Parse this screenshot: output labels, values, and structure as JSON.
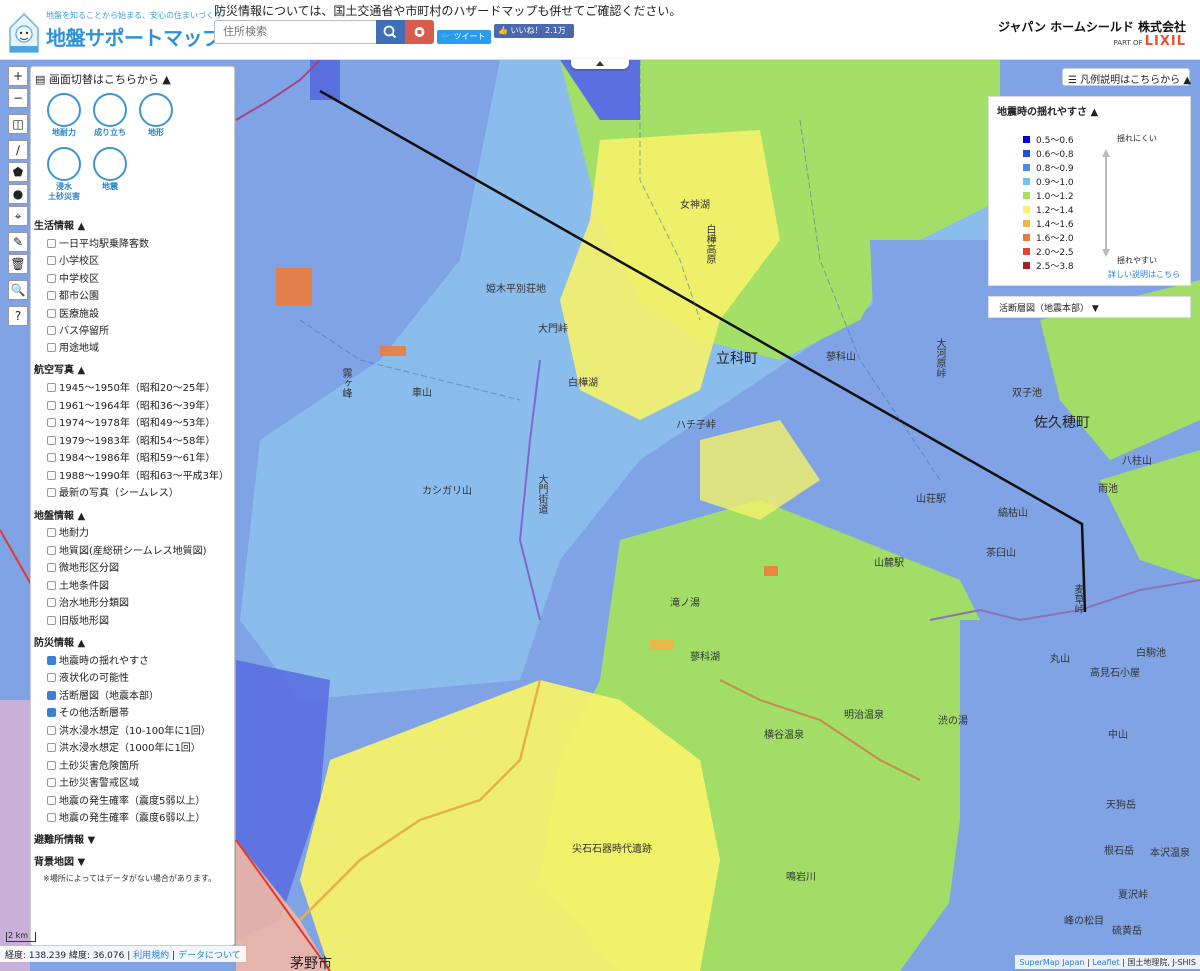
{
  "header": {
    "tagline": "地盤を知ることから始まる、安心の住まいづくり",
    "brand": "地盤サポートマップ",
    "notice": "防災情報については、国土交通省や市町村のハザードマップも併せてご確認ください。",
    "search_placeholder": "住所検索",
    "tweet_label": "ツイート",
    "like_label": "いいね！ 2.1万",
    "company": "ジャパン ホームシールド 株式会社",
    "partof": "PART OF",
    "partof_brand": "LIXIL"
  },
  "map_tools": [
    "+",
    "−",
    "◫",
    "∕",
    "⬟",
    "●",
    "⌖",
    "✎",
    "🗑",
    "🔍",
    "?"
  ],
  "left_panel": {
    "head": "画面切替はこちらから ▲",
    "views": [
      {
        "label": "地耐力",
        "icon": "house-ground-icon"
      },
      {
        "label": "成り立ち",
        "icon": "layers-icon"
      },
      {
        "label": "地形",
        "icon": "terrain-icon"
      },
      {
        "label": "浸水\n土砂災害",
        "icon": "flood-icon"
      },
      {
        "label": "地震",
        "icon": "earthquake-icon"
      }
    ],
    "sections": [
      {
        "title": "生活情報 ▲",
        "items": [
          {
            "label": "一日平均駅乗降客数",
            "checked": false
          },
          {
            "label": "小学校区",
            "checked": false
          },
          {
            "label": "中学校区",
            "checked": false
          },
          {
            "label": "都市公園",
            "checked": false
          },
          {
            "label": "医療施設",
            "checked": false
          },
          {
            "label": "バス停留所",
            "checked": false
          },
          {
            "label": "用途地域",
            "checked": false
          }
        ]
      },
      {
        "title": "航空写真 ▲",
        "items": [
          {
            "label": "1945〜1950年（昭和20〜25年）",
            "checked": false
          },
          {
            "label": "1961〜1964年（昭和36〜39年）",
            "checked": false
          },
          {
            "label": "1974〜1978年（昭和49〜53年）",
            "checked": false
          },
          {
            "label": "1979〜1983年（昭和54〜58年）",
            "checked": false
          },
          {
            "label": "1984〜1986年（昭和59〜61年）",
            "checked": false
          },
          {
            "label": "1988〜1990年（昭和63〜平成3年）",
            "checked": false
          },
          {
            "label": "最新の写真（シームレス）",
            "checked": false
          }
        ]
      },
      {
        "title": "地盤情報 ▲",
        "items": [
          {
            "label": "地耐力",
            "checked": false
          },
          {
            "label": "地質図(産総研シームレス地質図)",
            "checked": false
          },
          {
            "label": "微地形区分図",
            "checked": false
          },
          {
            "label": "土地条件図",
            "checked": false
          },
          {
            "label": "治水地形分類図",
            "checked": false
          },
          {
            "label": "旧版地形図",
            "checked": false
          }
        ]
      },
      {
        "title": "防災情報 ▲",
        "items": [
          {
            "label": "地震時の揺れやすさ",
            "checked": true
          },
          {
            "label": "液状化の可能性",
            "checked": false
          },
          {
            "label": "活断層図（地震本部）",
            "checked": true
          },
          {
            "label": "その他活断層帯",
            "checked": true
          },
          {
            "label": "洪水浸水想定（10-100年に1回）",
            "checked": false
          },
          {
            "label": "洪水浸水想定（1000年に1回）",
            "checked": false
          },
          {
            "label": "土砂災害危険箇所",
            "checked": false
          },
          {
            "label": "土砂災害警戒区域",
            "checked": false
          },
          {
            "label": "地震の発生確率（震度5弱以上）",
            "checked": false
          },
          {
            "label": "地震の発生確率（震度6弱以上）",
            "checked": false
          }
        ]
      }
    ],
    "collapsed": [
      "避難所情報 ▼",
      "背景地図 ▼"
    ],
    "note": "※場所によってはデータがない場合があります。"
  },
  "legend": {
    "button": "凡例説明はこちらから ▲",
    "title": "地震時の揺れやすさ ▲",
    "rows": [
      {
        "label": "0.5〜0.6",
        "color": "#0000e0"
      },
      {
        "label": "0.6〜0.8",
        "color": "#1f4fe0"
      },
      {
        "label": "0.8〜0.9",
        "color": "#4f8ae6"
      },
      {
        "label": "0.9〜1.0",
        "color": "#6ec7ef"
      },
      {
        "label": "1.0〜1.2",
        "color": "#a6e35a"
      },
      {
        "label": "1.2〜1.4",
        "color": "#f6f269"
      },
      {
        "label": "1.4〜1.6",
        "color": "#f2b248"
      },
      {
        "label": "1.6〜2.0",
        "color": "#ef7b3a"
      },
      {
        "label": "2.0〜2.5",
        "color": "#e4452e"
      },
      {
        "label": "2.5〜3.8",
        "color": "#a82228"
      }
    ],
    "low": "揺れにくい",
    "high": "揺れやすい",
    "detail": "詳しい説明はこちら",
    "fault": "活断層図（地震本部） ▼"
  },
  "map_labels": [
    {
      "text": "立科町",
      "big": true
    },
    {
      "text": "佐久穂町",
      "big": true
    },
    {
      "text": "茅野市",
      "big": true
    },
    {
      "text": "姫木平別荘地"
    },
    {
      "text": "大門峠"
    },
    {
      "text": "白樺湖"
    },
    {
      "text": "女神湖"
    },
    {
      "text": "蓼科山"
    },
    {
      "text": "双子池"
    },
    {
      "text": "大河原峠"
    },
    {
      "text": "八柱山"
    },
    {
      "text": "雨池"
    },
    {
      "text": "山荘駅"
    },
    {
      "text": "縞枯山"
    },
    {
      "text": "茶臼山"
    },
    {
      "text": "山麓駅"
    },
    {
      "text": "白駒池"
    },
    {
      "text": "丸山"
    },
    {
      "text": "高見石小屋"
    },
    {
      "text": "蓼科湖"
    },
    {
      "text": "横谷温泉"
    },
    {
      "text": "明治温泉"
    },
    {
      "text": "渋の湯"
    },
    {
      "text": "中山"
    },
    {
      "text": "天狗岳"
    },
    {
      "text": "根石岳"
    },
    {
      "text": "夏沢峠"
    },
    {
      "text": "峰の松目"
    },
    {
      "text": "硫黄岳"
    },
    {
      "text": "本沢温泉"
    },
    {
      "text": "尖石石器時代遺跡"
    },
    {
      "text": "鳴岩川"
    },
    {
      "text": "滝ノ湯"
    },
    {
      "text": "カシガリ山"
    },
    {
      "text": "車山"
    },
    {
      "text": "白樺高原"
    },
    {
      "text": "大門街道"
    },
    {
      "text": "霧ヶ峰"
    },
    {
      "text": "麦草峠"
    },
    {
      "text": "ハチ子峠"
    }
  ],
  "scale": "2 km",
  "coords": {
    "text": "経度: 138.239 緯度: 36.076",
    "terms": "利用規約",
    "about": "データについて"
  },
  "attribution": {
    "a": "SuperMap Japan",
    "b": "Leaflet",
    "c": "国土地理院, J-SHIS"
  }
}
